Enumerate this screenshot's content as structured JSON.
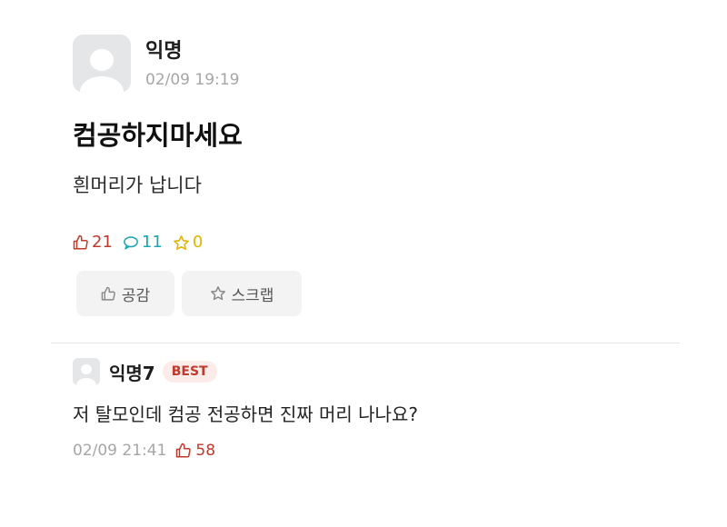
{
  "post": {
    "author": "익명",
    "time": "02/09 19:19",
    "title": "컴공하지마세요",
    "body": "흰머리가 납니다",
    "stats": {
      "likes": "21",
      "comments": "11",
      "scraps": "0"
    },
    "actions": {
      "like_label": "공감",
      "scrap_label": "스크랩"
    }
  },
  "comment": {
    "author": "익명7",
    "badge": "BEST",
    "text": "저 탈모인데 컴공 전공하면 진짜 머리 나나요?",
    "time": "02/09 21:41",
    "likes": "58"
  },
  "colors": {
    "like": "#c0392b",
    "comment": "#1aa5b3",
    "scrap": "#e0b400",
    "badge_bg": "#fbecea"
  },
  "icons": {
    "like": "thumbs-up-icon",
    "comment": "speech-bubble-icon",
    "scrap": "star-icon",
    "avatar": "default-avatar-icon"
  }
}
